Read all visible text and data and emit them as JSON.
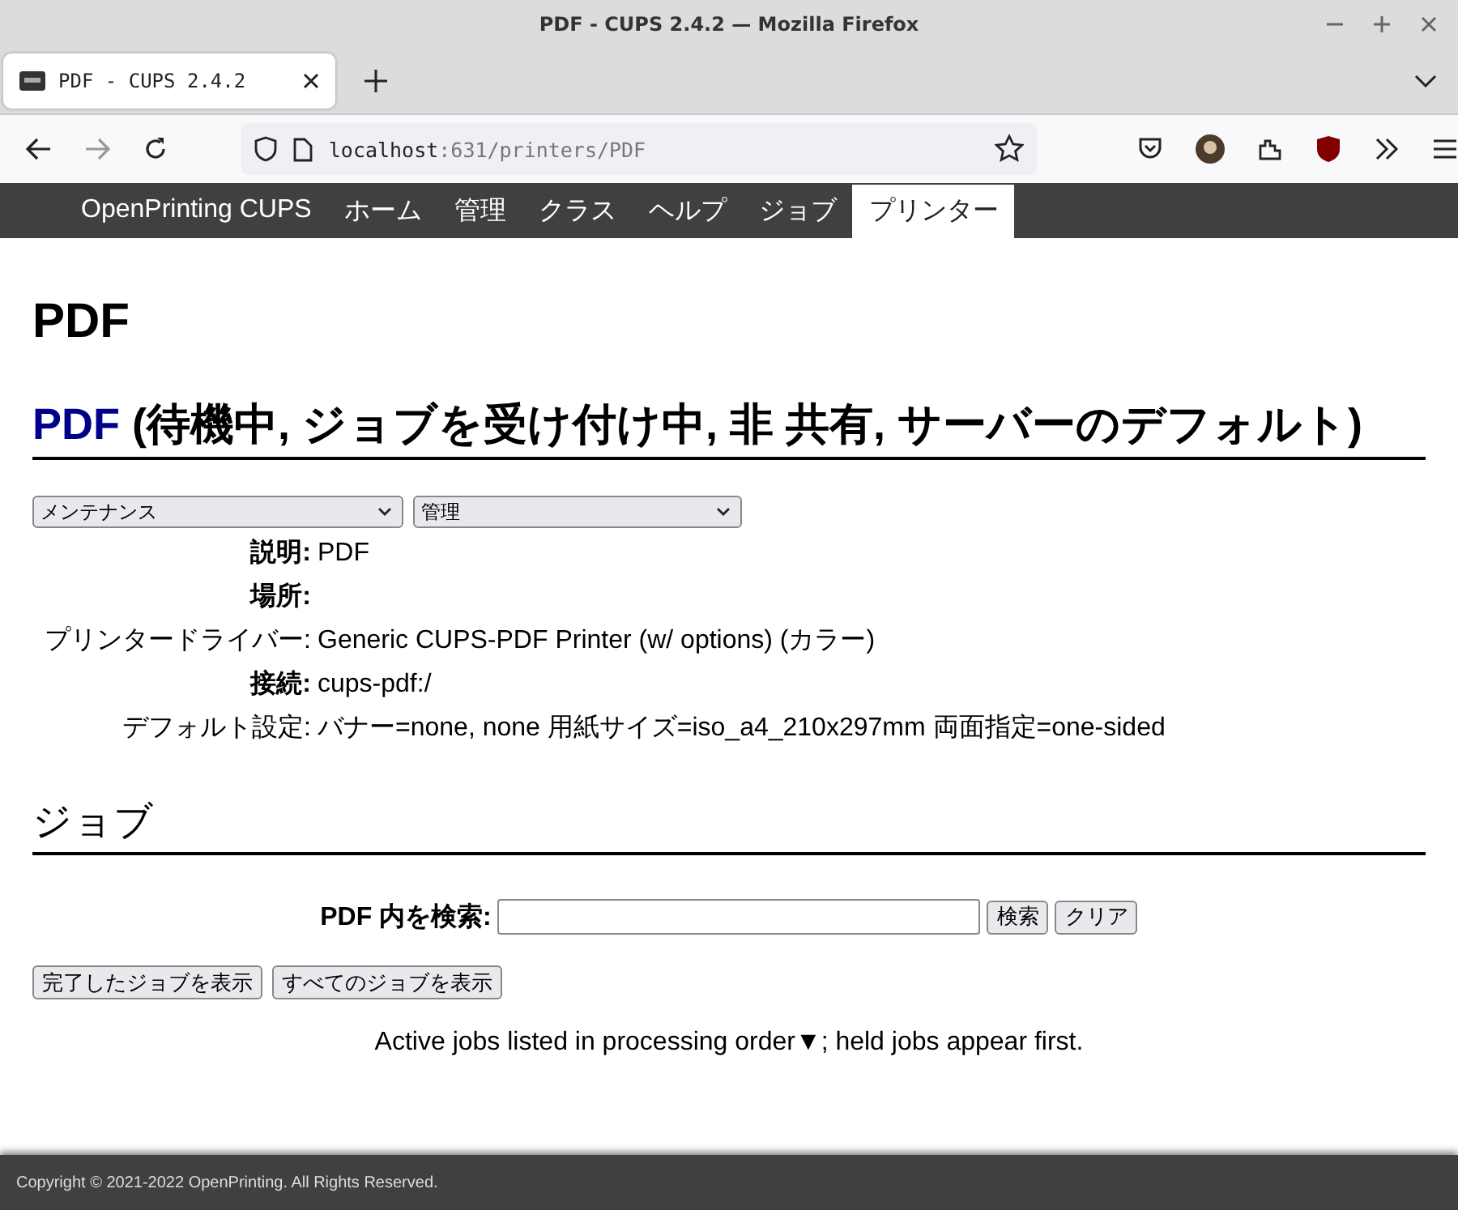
{
  "window": {
    "title": "PDF - CUPS 2.4.2 — Mozilla Firefox"
  },
  "tabs": [
    {
      "label": "PDF - CUPS 2.4.2",
      "selected": true
    }
  ],
  "address_bar": {
    "host": "localhost",
    "rest": ":631/printers/PDF"
  },
  "site_nav": {
    "brand": "OpenPrinting CUPS",
    "items": [
      {
        "label": "ホーム",
        "selected": false
      },
      {
        "label": "管理",
        "selected": false
      },
      {
        "label": "クラス",
        "selected": false
      },
      {
        "label": "ヘルプ",
        "selected": false
      },
      {
        "label": "ジョブ",
        "selected": false
      },
      {
        "label": "プリンター",
        "selected": true
      }
    ]
  },
  "page_title": "PDF",
  "printer_heading": {
    "link": "PDF",
    "status": "(待機中, ジョブを受け付け中, 非 共有, サーバーのデフォルト)"
  },
  "selects": [
    "メンテナンス",
    "管理"
  ],
  "properties": [
    {
      "label": "説明:",
      "value": "PDF"
    },
    {
      "label": "場所:"
    },
    {
      "label": "プリンタードライバー:",
      "value": "Generic CUPS-PDF Printer (w/ options) (カラー)"
    },
    {
      "label": "接続:",
      "value": "cups-pdf:/"
    },
    {
      "label": "デフォルト設定:",
      "value": "バナー=none, none 用紙サイズ=iso_a4_210x297mm 両面指定=one-sided"
    }
  ],
  "jobs_heading": "ジョブ",
  "search": {
    "label": "PDF 内を検索:",
    "buttons": [
      "検索",
      "クリア"
    ]
  },
  "job_buttons": [
    "完了したジョブを表示",
    "すべてのジョブを表示"
  ],
  "note": "Active jobs listed in processing order▼; held jobs appear first.",
  "footer": "Copyright © 2021-2022 OpenPrinting. All Rights Reserved."
}
